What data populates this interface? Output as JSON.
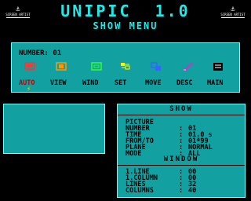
{
  "header": {
    "title": "UNIPIC  1.0",
    "subtitle": "SHOW MENU",
    "corner_glyph": "⚓",
    "corner_caption": "SCREEN ARTIST"
  },
  "menu": {
    "number_label": "NUMBER:",
    "number_value": "01",
    "items": [
      {
        "label": "AUTO",
        "icon": "auto-icon",
        "color": "#ff3333",
        "active": true
      },
      {
        "label": "VIEW",
        "icon": "view-icon",
        "color": "#ff9900",
        "active": false
      },
      {
        "label": "WIND",
        "icon": "wind-icon",
        "color": "#33ff33",
        "active": false
      },
      {
        "label": "SET",
        "icon": "set-icon",
        "color": "#ffff00",
        "active": false
      },
      {
        "label": "MOVE",
        "icon": "move-icon",
        "color": "#3366ff",
        "active": false
      },
      {
        "label": "DESC",
        "icon": "desc-icon",
        "color": "#cc33cc",
        "active": false
      },
      {
        "label": "MAIN",
        "icon": "main-icon",
        "color": "#000000",
        "active": false
      }
    ],
    "cursor_glyph": "⚡"
  },
  "show": {
    "header": "SHOW",
    "rows": [
      {
        "key": "PICTURE",
        "sep": "",
        "value": ""
      },
      {
        "key": "NUMBER",
        "sep": ":",
        "value": "01"
      },
      {
        "key": "TIME",
        "sep": ":",
        "value": "01.0 s"
      },
      {
        "key": "FROM/TO",
        "sep": ":",
        "value": "01ª99"
      },
      {
        "key": "PLANE",
        "sep": ":",
        "value": "NORMAL"
      },
      {
        "key": "MODE",
        "sep": ":",
        "value": "ALL"
      }
    ]
  },
  "window": {
    "header": "WINDOW",
    "rows": [
      {
        "key": "1.LINE",
        "sep": ":",
        "value": "00"
      },
      {
        "key": "1.COLUMN",
        "sep": ":",
        "value": "00"
      },
      {
        "key": "LINES",
        "sep": ":",
        "value": "32"
      },
      {
        "key": "COLUMNS",
        "sep": ":",
        "value": "40"
      }
    ]
  },
  "colors": {
    "panel": "#12a0a0",
    "title": "#22e8e8",
    "background": "#000000"
  }
}
